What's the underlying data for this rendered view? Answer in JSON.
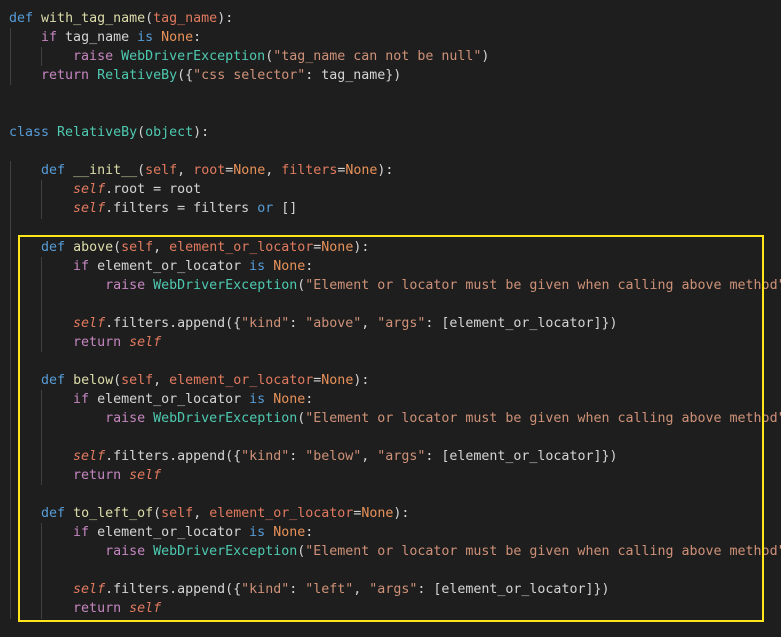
{
  "editor": {
    "theme": "dark",
    "accent_highlight_color": "#ffe51a",
    "colors": {
      "keyword": "#569cd6",
      "function": "#dcdcaa",
      "class": "#4ec9b0",
      "param": "#e07a5f",
      "string": "#ce9178",
      "control": "#c586c0",
      "builtin_const": "#e8925a",
      "text": "#d4d4d4"
    },
    "lines": [
      [
        [
          "kw",
          "def"
        ],
        [
          "txt",
          " "
        ],
        [
          "fn",
          "with_tag_name"
        ],
        [
          "txt",
          "("
        ],
        [
          "prm",
          "tag_name"
        ],
        [
          "txt",
          "):"
        ]
      ],
      [
        [
          "txt",
          "    "
        ],
        [
          "ctl",
          "if"
        ],
        [
          "txt",
          " tag_name "
        ],
        [
          "kw",
          "is"
        ],
        [
          "txt",
          " "
        ],
        [
          "none",
          "None"
        ],
        [
          "txt",
          ":"
        ]
      ],
      [
        [
          "txt",
          "        "
        ],
        [
          "ctl",
          "raise"
        ],
        [
          "txt",
          " "
        ],
        [
          "cls",
          "WebDriverException"
        ],
        [
          "txt",
          "("
        ],
        [
          "str",
          "\"tag_name can not be null\""
        ],
        [
          "txt",
          ")"
        ]
      ],
      [
        [
          "txt",
          "    "
        ],
        [
          "ctl",
          "return"
        ],
        [
          "txt",
          " "
        ],
        [
          "cls",
          "RelativeBy"
        ],
        [
          "txt",
          "({"
        ],
        [
          "str",
          "\"css selector\""
        ],
        [
          "txt",
          ": tag_name})"
        ]
      ],
      [],
      [],
      [
        [
          "kw",
          "class"
        ],
        [
          "txt",
          " "
        ],
        [
          "cls",
          "RelativeBy"
        ],
        [
          "txt",
          "("
        ],
        [
          "cls",
          "object"
        ],
        [
          "txt",
          "):"
        ]
      ],
      [],
      [
        [
          "txt",
          "    "
        ],
        [
          "kw",
          "def"
        ],
        [
          "txt",
          " "
        ],
        [
          "fn",
          "__init__"
        ],
        [
          "txt",
          "("
        ],
        [
          "prm",
          "self"
        ],
        [
          "txt",
          ", "
        ],
        [
          "prm",
          "root"
        ],
        [
          "txt",
          "="
        ],
        [
          "none",
          "None"
        ],
        [
          "txt",
          ", "
        ],
        [
          "prm",
          "filters"
        ],
        [
          "txt",
          "="
        ],
        [
          "none",
          "None"
        ],
        [
          "txt",
          "):"
        ]
      ],
      [
        [
          "txt",
          "        "
        ],
        [
          "self",
          "self"
        ],
        [
          "txt",
          ".root = root"
        ]
      ],
      [
        [
          "txt",
          "        "
        ],
        [
          "self",
          "self"
        ],
        [
          "txt",
          ".filters = filters "
        ],
        [
          "kw",
          "or"
        ],
        [
          "txt",
          " []"
        ]
      ],
      [],
      [
        [
          "txt",
          "    "
        ],
        [
          "kw",
          "def"
        ],
        [
          "txt",
          " "
        ],
        [
          "fn",
          "above"
        ],
        [
          "txt",
          "("
        ],
        [
          "prm",
          "self"
        ],
        [
          "txt",
          ", "
        ],
        [
          "prm",
          "element_or_locator"
        ],
        [
          "txt",
          "="
        ],
        [
          "none",
          "None"
        ],
        [
          "txt",
          "):"
        ]
      ],
      [
        [
          "txt",
          "        "
        ],
        [
          "ctl",
          "if"
        ],
        [
          "txt",
          " element_or_locator "
        ],
        [
          "kw",
          "is"
        ],
        [
          "txt",
          " "
        ],
        [
          "none",
          "None"
        ],
        [
          "txt",
          ":"
        ]
      ],
      [
        [
          "txt",
          "            "
        ],
        [
          "ctl",
          "raise"
        ],
        [
          "txt",
          " "
        ],
        [
          "cls",
          "WebDriverException"
        ],
        [
          "txt",
          "("
        ],
        [
          "str",
          "\"Element or locator must be given when calling above method\""
        ],
        [
          "txt",
          ")"
        ]
      ],
      [],
      [
        [
          "txt",
          "        "
        ],
        [
          "self",
          "self"
        ],
        [
          "txt",
          ".filters.append({"
        ],
        [
          "str",
          "\"kind\""
        ],
        [
          "txt",
          ": "
        ],
        [
          "str",
          "\"above\""
        ],
        [
          "txt",
          ", "
        ],
        [
          "str",
          "\"args\""
        ],
        [
          "txt",
          ": [element_or_locator]})"
        ]
      ],
      [
        [
          "txt",
          "        "
        ],
        [
          "ctl",
          "return"
        ],
        [
          "txt",
          " "
        ],
        [
          "self",
          "self"
        ]
      ],
      [],
      [
        [
          "txt",
          "    "
        ],
        [
          "kw",
          "def"
        ],
        [
          "txt",
          " "
        ],
        [
          "fn",
          "below"
        ],
        [
          "txt",
          "("
        ],
        [
          "prm",
          "self"
        ],
        [
          "txt",
          ", "
        ],
        [
          "prm",
          "element_or_locator"
        ],
        [
          "txt",
          "="
        ],
        [
          "none",
          "None"
        ],
        [
          "txt",
          "):"
        ]
      ],
      [
        [
          "txt",
          "        "
        ],
        [
          "ctl",
          "if"
        ],
        [
          "txt",
          " element_or_locator "
        ],
        [
          "kw",
          "is"
        ],
        [
          "txt",
          " "
        ],
        [
          "none",
          "None"
        ],
        [
          "txt",
          ":"
        ]
      ],
      [
        [
          "txt",
          "            "
        ],
        [
          "ctl",
          "raise"
        ],
        [
          "txt",
          " "
        ],
        [
          "cls",
          "WebDriverException"
        ],
        [
          "txt",
          "("
        ],
        [
          "str",
          "\"Element or locator must be given when calling above method\""
        ],
        [
          "txt",
          ")"
        ]
      ],
      [],
      [
        [
          "txt",
          "        "
        ],
        [
          "self",
          "self"
        ],
        [
          "txt",
          ".filters.append({"
        ],
        [
          "str",
          "\"kind\""
        ],
        [
          "txt",
          ": "
        ],
        [
          "str",
          "\"below\""
        ],
        [
          "txt",
          ", "
        ],
        [
          "str",
          "\"args\""
        ],
        [
          "txt",
          ": [element_or_locator]})"
        ]
      ],
      [
        [
          "txt",
          "        "
        ],
        [
          "ctl",
          "return"
        ],
        [
          "txt",
          " "
        ],
        [
          "self",
          "self"
        ]
      ],
      [],
      [
        [
          "txt",
          "    "
        ],
        [
          "kw",
          "def"
        ],
        [
          "txt",
          " "
        ],
        [
          "fn",
          "to_left_of"
        ],
        [
          "txt",
          "("
        ],
        [
          "prm",
          "self"
        ],
        [
          "txt",
          ", "
        ],
        [
          "prm",
          "element_or_locator"
        ],
        [
          "txt",
          "="
        ],
        [
          "none",
          "None"
        ],
        [
          "txt",
          "):"
        ]
      ],
      [
        [
          "txt",
          "        "
        ],
        [
          "ctl",
          "if"
        ],
        [
          "txt",
          " element_or_locator "
        ],
        [
          "kw",
          "is"
        ],
        [
          "txt",
          " "
        ],
        [
          "none",
          "None"
        ],
        [
          "txt",
          ":"
        ]
      ],
      [
        [
          "txt",
          "            "
        ],
        [
          "ctl",
          "raise"
        ],
        [
          "txt",
          " "
        ],
        [
          "cls",
          "WebDriverException"
        ],
        [
          "txt",
          "("
        ],
        [
          "str",
          "\"Element or locator must be given when calling above method\""
        ],
        [
          "txt",
          ")"
        ]
      ],
      [],
      [
        [
          "txt",
          "        "
        ],
        [
          "self",
          "self"
        ],
        [
          "txt",
          ".filters.append({"
        ],
        [
          "str",
          "\"kind\""
        ],
        [
          "txt",
          ": "
        ],
        [
          "str",
          "\"left\""
        ],
        [
          "txt",
          ", "
        ],
        [
          "str",
          "\"args\""
        ],
        [
          "txt",
          ": [element_or_locator]})"
        ]
      ],
      [
        [
          "txt",
          "        "
        ],
        [
          "ctl",
          "return"
        ],
        [
          "txt",
          " "
        ],
        [
          "self",
          "self"
        ]
      ]
    ]
  }
}
